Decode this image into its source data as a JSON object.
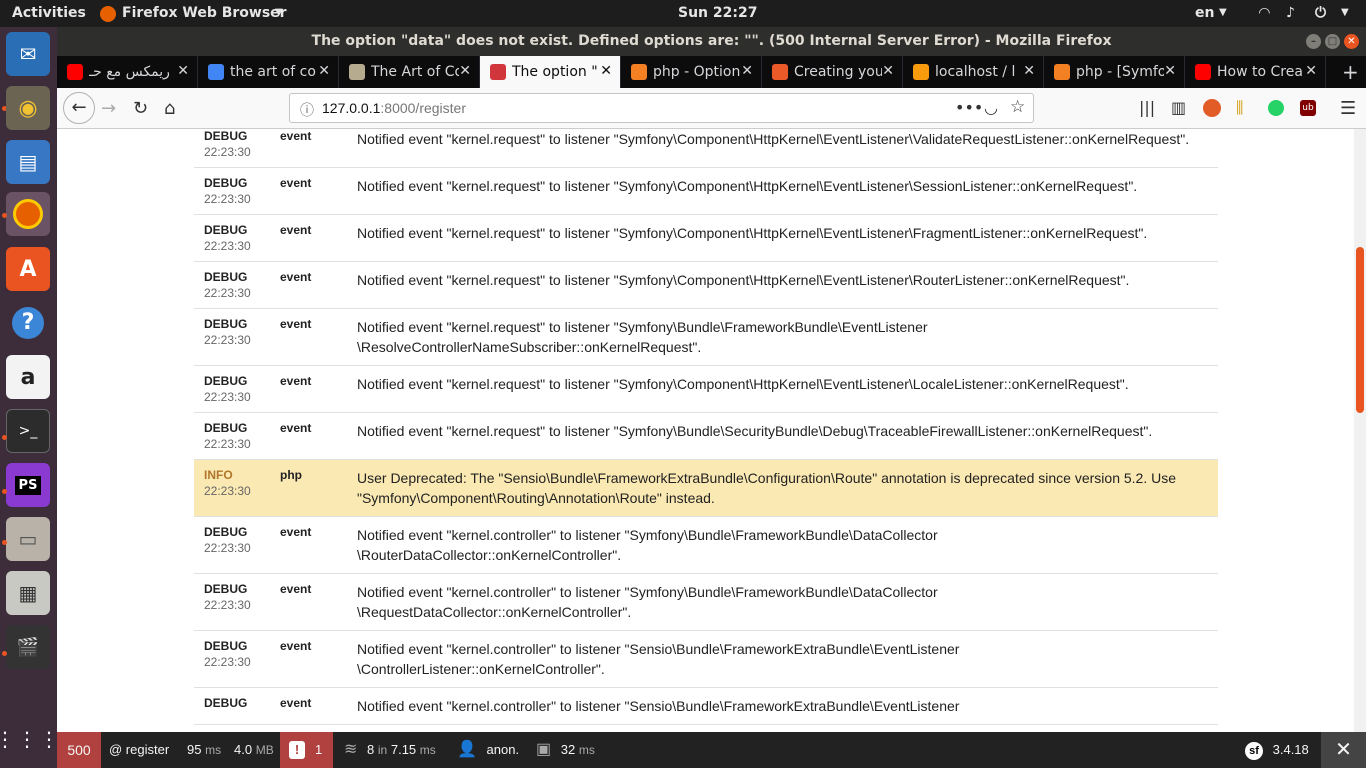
{
  "system_bar": {
    "activities": "Activities",
    "app_menu": "Firefox Web Browser",
    "clock": "Sun 22:27",
    "lang": "en"
  },
  "window": {
    "title": "The option \"data\" does not exist. Defined options are: \"\". (500 Internal Server Error) - Mozilla Firefox"
  },
  "tabs": [
    {
      "label": "ريمكس مع حـ",
      "favicon": "youtube-icon",
      "color": "#ff0000"
    },
    {
      "label": "the art of co",
      "favicon": "google-icon",
      "color": "#4285f4"
    },
    {
      "label": "The Art of Co",
      "favicon": "goodreads-icon",
      "color": "#b7ab8f"
    },
    {
      "label": "The option \"",
      "favicon": "symfony-ghost-icon",
      "color": "#d0363b"
    },
    {
      "label": "php - Option",
      "favicon": "stackoverflow-icon",
      "color": "#f48024"
    },
    {
      "label": "Creating you",
      "favicon": "symfony-red-icon",
      "color": "#ea5a29"
    },
    {
      "label": "localhost / l",
      "favicon": "phpmyadmin-icon",
      "color": "#f89c0e"
    },
    {
      "label": "php - [Symfo",
      "favicon": "stackoverflow-icon",
      "color": "#f48024"
    },
    {
      "label": "How to Crea",
      "favicon": "youtube-icon",
      "color": "#ff0000"
    }
  ],
  "address": {
    "host": "127.0.0.1",
    "rest": ":8000/register"
  },
  "logs": [
    {
      "level": "DEBUG",
      "time": "22:23:30",
      "channel": "event",
      "message": "Notified event \"kernel.request\" to listener \"Symfony\\Component\\HttpKernel\\EventListener\\ValidateRequestListener::onKernelRequest\"."
    },
    {
      "level": "DEBUG",
      "time": "22:23:30",
      "channel": "event",
      "message": "Notified event \"kernel.request\" to listener \"Symfony\\Component\\HttpKernel\\EventListener\\SessionListener::onKernelRequest\"."
    },
    {
      "level": "DEBUG",
      "time": "22:23:30",
      "channel": "event",
      "message": "Notified event \"kernel.request\" to listener \"Symfony\\Component\\HttpKernel\\EventListener\\FragmentListener::onKernelRequest\"."
    },
    {
      "level": "DEBUG",
      "time": "22:23:30",
      "channel": "event",
      "message": "Notified event \"kernel.request\" to listener \"Symfony\\Component\\HttpKernel\\EventListener\\RouterListener::onKernelRequest\"."
    },
    {
      "level": "DEBUG",
      "time": "22:23:30",
      "channel": "event",
      "message": "Notified event \"kernel.request\" to listener \"Symfony\\Bundle\\FrameworkBundle\\EventListener\n\\ResolveControllerNameSubscriber::onKernelRequest\"."
    },
    {
      "level": "DEBUG",
      "time": "22:23:30",
      "channel": "event",
      "message": "Notified event \"kernel.request\" to listener \"Symfony\\Component\\HttpKernel\\EventListener\\LocaleListener::onKernelRequest\"."
    },
    {
      "level": "DEBUG",
      "time": "22:23:30",
      "channel": "event",
      "message": "Notified event \"kernel.request\" to listener \"Symfony\\Bundle\\SecurityBundle\\Debug\\TraceableFirewallListener::onKernelRequest\"."
    },
    {
      "level": "INFO",
      "time": "22:23:30",
      "channel": "php",
      "message": "User Deprecated: The \"Sensio\\Bundle\\FrameworkExtraBundle\\Configuration\\Route\" annotation is deprecated since version 5.2. Use\n\"Symfony\\Component\\Routing\\Annotation\\Route\" instead."
    },
    {
      "level": "DEBUG",
      "time": "22:23:30",
      "channel": "event",
      "message": "Notified event \"kernel.controller\" to listener \"Symfony\\Bundle\\FrameworkBundle\\DataCollector\n\\RouterDataCollector::onKernelController\"."
    },
    {
      "level": "DEBUG",
      "time": "22:23:30",
      "channel": "event",
      "message": "Notified event \"kernel.controller\" to listener \"Symfony\\Bundle\\FrameworkBundle\\DataCollector\n\\RequestDataCollector::onKernelController\"."
    },
    {
      "level": "DEBUG",
      "time": "22:23:30",
      "channel": "event",
      "message": "Notified event \"kernel.controller\" to listener \"Sensio\\Bundle\\FrameworkExtraBundle\\EventListener\n\\ControllerListener::onKernelController\"."
    },
    {
      "level": "DEBUG",
      "time": "",
      "channel": "event",
      "message": "Notified event \"kernel.controller\" to listener \"Sensio\\Bundle\\FrameworkExtraBundle\\EventListener"
    }
  ],
  "toolbar": {
    "status": "500",
    "route": "@ register",
    "time_value": "95",
    "time_unit": "ms",
    "memory_value": "4.0",
    "memory_unit": "MB",
    "errors": "1",
    "events": "8",
    "events_in": "in",
    "events_time": "7.15",
    "events_unit": "ms",
    "user": "anon.",
    "render_time": "32",
    "render_unit": "ms",
    "version": "3.4.18"
  },
  "colors": {
    "error_red": "#b0413e",
    "accent_orange": "#e95420",
    "info_row": "#fbe9b3"
  }
}
